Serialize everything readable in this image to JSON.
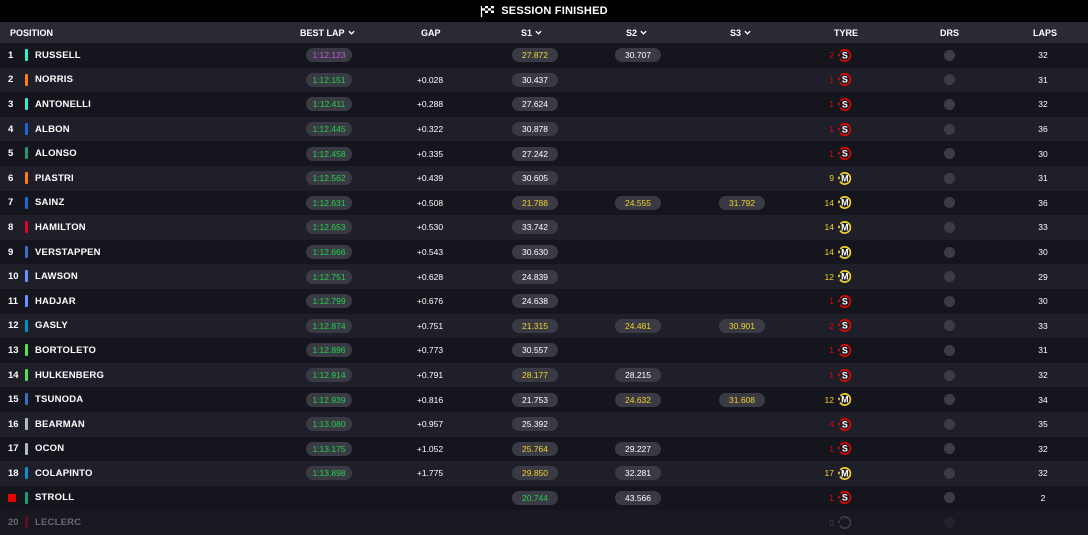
{
  "topbar": {
    "status": "SESSION FINISHED",
    "icon": "checkered-flag-icon"
  },
  "header": {
    "position": "POSITION",
    "best_lap": "BEST LAP",
    "gap": "GAP",
    "s1": "S1",
    "s2": "S2",
    "s3": "S3",
    "tyre": "TYRE",
    "drs": "DRS",
    "laps": "LAPS"
  },
  "colors": {
    "soft": "#e10600",
    "medium": "#f3d12a",
    "personal_best": "#24d04b",
    "overall_best": "#c45bd9"
  },
  "rows": [
    {
      "pos": "1",
      "name": "RUSSELL",
      "team_color": "#27f4d2",
      "best": "1:12.123",
      "best_purple": true,
      "gap": "",
      "s1": "27.872",
      "s1_style": "yellow",
      "s2": "30.707",
      "s2_style": "white",
      "s3": "",
      "s3_style": "",
      "tyre_age": "2",
      "tyre": "S",
      "laps": "32"
    },
    {
      "pos": "2",
      "name": "NORRIS",
      "team_color": "#ff8000",
      "best": "1:12.151",
      "best_purple": false,
      "gap": "+0.028",
      "s1": "30.437",
      "s1_style": "white",
      "s2": "",
      "s2_style": "",
      "s3": "",
      "s3_style": "",
      "tyre_age": "1",
      "tyre": "S",
      "laps": "31"
    },
    {
      "pos": "3",
      "name": "ANTONELLI",
      "team_color": "#27f4d2",
      "best": "1:12.411",
      "best_purple": false,
      "gap": "+0.288",
      "s1": "27.624",
      "s1_style": "white",
      "s2": "",
      "s2_style": "",
      "s3": "",
      "s3_style": "",
      "tyre_age": "1",
      "tyre": "S",
      "laps": "32"
    },
    {
      "pos": "4",
      "name": "ALBON",
      "team_color": "#1868db",
      "best": "1:12.445",
      "best_purple": false,
      "gap": "+0.322",
      "s1": "30.878",
      "s1_style": "white",
      "s2": "",
      "s2_style": "",
      "s3": "",
      "s3_style": "",
      "tyre_age": "1",
      "tyre": "S",
      "laps": "36"
    },
    {
      "pos": "5",
      "name": "ALONSO",
      "team_color": "#229971",
      "best": "1:12.458",
      "best_purple": false,
      "gap": "+0.335",
      "s1": "27.242",
      "s1_style": "white",
      "s2": "",
      "s2_style": "",
      "s3": "",
      "s3_style": "",
      "tyre_age": "1",
      "tyre": "S",
      "laps": "30"
    },
    {
      "pos": "6",
      "name": "PIASTRI",
      "team_color": "#ff8000",
      "best": "1:12.562",
      "best_purple": false,
      "gap": "+0.439",
      "s1": "30.605",
      "s1_style": "white",
      "s2": "",
      "s2_style": "",
      "s3": "",
      "s3_style": "",
      "tyre_age": "9",
      "tyre": "M",
      "laps": "31"
    },
    {
      "pos": "7",
      "name": "SAINZ",
      "team_color": "#1868db",
      "best": "1:12.631",
      "best_purple": false,
      "gap": "+0.508",
      "s1": "21.788",
      "s1_style": "yellow",
      "s2": "24.555",
      "s2_style": "yellow",
      "s3": "31.792",
      "s3_style": "yellow",
      "tyre_age": "14",
      "tyre": "M",
      "laps": "36"
    },
    {
      "pos": "8",
      "name": "HAMILTON",
      "team_color": "#e8002d",
      "best": "1:12.653",
      "best_purple": false,
      "gap": "+0.530",
      "s1": "33.742",
      "s1_style": "white",
      "s2": "",
      "s2_style": "",
      "s3": "",
      "s3_style": "",
      "tyre_age": "14",
      "tyre": "M",
      "laps": "33"
    },
    {
      "pos": "9",
      "name": "VERSTAPPEN",
      "team_color": "#3671c6",
      "best": "1:12.666",
      "best_purple": false,
      "gap": "+0.543",
      "s1": "30.630",
      "s1_style": "white",
      "s2": "",
      "s2_style": "",
      "s3": "",
      "s3_style": "",
      "tyre_age": "14",
      "tyre": "M",
      "laps": "30"
    },
    {
      "pos": "10",
      "name": "LAWSON",
      "team_color": "#6692ff",
      "best": "1:12.751",
      "best_purple": false,
      "gap": "+0.628",
      "s1": "24.839",
      "s1_style": "white",
      "s2": "",
      "s2_style": "",
      "s3": "",
      "s3_style": "",
      "tyre_age": "12",
      "tyre": "M",
      "laps": "29"
    },
    {
      "pos": "11",
      "name": "HADJAR",
      "team_color": "#6692ff",
      "best": "1:12.799",
      "best_purple": false,
      "gap": "+0.676",
      "s1": "24.638",
      "s1_style": "white",
      "s2": "",
      "s2_style": "",
      "s3": "",
      "s3_style": "",
      "tyre_age": "1",
      "tyre": "S",
      "laps": "30"
    },
    {
      "pos": "12",
      "name": "GASLY",
      "team_color": "#0093cc",
      "best": "1:12.874",
      "best_purple": false,
      "gap": "+0.751",
      "s1": "21.315",
      "s1_style": "yellow",
      "s2": "24.481",
      "s2_style": "yellow",
      "s3": "30.901",
      "s3_style": "yellow",
      "tyre_age": "2",
      "tyre": "S",
      "laps": "33"
    },
    {
      "pos": "13",
      "name": "BORTOLETO",
      "team_color": "#52e252",
      "best": "1:12.896",
      "best_purple": false,
      "gap": "+0.773",
      "s1": "30.557",
      "s1_style": "white",
      "s2": "",
      "s2_style": "",
      "s3": "",
      "s3_style": "",
      "tyre_age": "1",
      "tyre": "S",
      "laps": "31"
    },
    {
      "pos": "14",
      "name": "HULKENBERG",
      "team_color": "#52e252",
      "best": "1:12.914",
      "best_purple": false,
      "gap": "+0.791",
      "s1": "28.177",
      "s1_style": "yellow",
      "s2": "28.215",
      "s2_style": "white",
      "s3": "",
      "s3_style": "",
      "tyre_age": "1",
      "tyre": "S",
      "laps": "32"
    },
    {
      "pos": "15",
      "name": "TSUNODA",
      "team_color": "#3671c6",
      "best": "1:12.939",
      "best_purple": false,
      "gap": "+0.816",
      "s1": "21.753",
      "s1_style": "white",
      "s2": "24.632",
      "s2_style": "yellow",
      "s3": "31.608",
      "s3_style": "yellow",
      "tyre_age": "12",
      "tyre": "M",
      "laps": "34"
    },
    {
      "pos": "16",
      "name": "BEARMAN",
      "team_color": "#b6babd",
      "best": "1:13.080",
      "best_purple": false,
      "gap": "+0.957",
      "s1": "25.392",
      "s1_style": "white",
      "s2": "",
      "s2_style": "",
      "s3": "",
      "s3_style": "",
      "tyre_age": "4",
      "tyre": "S",
      "laps": "35"
    },
    {
      "pos": "17",
      "name": "OCON",
      "team_color": "#b6babd",
      "best": "1:13.175",
      "best_purple": false,
      "gap": "+1.052",
      "s1": "25.764",
      "s1_style": "yellow",
      "s2": "29.227",
      "s2_style": "white",
      "s3": "",
      "s3_style": "",
      "tyre_age": "1",
      "tyre": "S",
      "laps": "32"
    },
    {
      "pos": "18",
      "name": "COLAPINTO",
      "team_color": "#0093cc",
      "best": "1:13.898",
      "best_purple": false,
      "gap": "+1.775",
      "s1": "29.850",
      "s1_style": "yellow",
      "s2": "32.281",
      "s2_style": "white",
      "s3": "",
      "s3_style": "",
      "tyre_age": "17",
      "tyre": "M",
      "laps": "32"
    },
    {
      "pos": "",
      "name": "STROLL",
      "team_color": "#229971",
      "best": "",
      "best_purple": false,
      "gap": "",
      "s1": "20.744",
      "s1_style": "green",
      "s2": "43.566",
      "s2_style": "white",
      "s3": "",
      "s3_style": "",
      "tyre_age": "1",
      "tyre": "S",
      "laps": "2",
      "pos_box": true
    },
    {
      "pos": "20",
      "name": "LECLERC",
      "team_color": "#e8002d",
      "best": "",
      "best_purple": false,
      "gap": "",
      "s1": "",
      "s1_style": "",
      "s2": "",
      "s2_style": "",
      "s3": "",
      "s3_style": "",
      "tyre_age": "0",
      "tyre": "",
      "laps": "",
      "dimmed": true
    }
  ]
}
